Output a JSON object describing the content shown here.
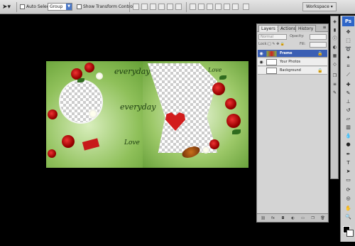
{
  "options_bar": {
    "auto_select_label": "Auto Select:",
    "auto_select_value": "Group",
    "transform_controls_label": "Show Transform Controls",
    "workspace_label": "Workspace"
  },
  "canvas_text": {
    "script1": "everyday",
    "script2": "everyday",
    "script3": "Love",
    "script4": "Love"
  },
  "layers_panel": {
    "tabs": [
      "Layers",
      "Actions",
      "History"
    ],
    "tab_close": "×",
    "blend_mode": "Normal",
    "opacity_label": "Opacity:",
    "lock_label": "Lock:",
    "fill_label": "Fill:",
    "layers": [
      {
        "name": "Frame",
        "selected": true,
        "visible": true,
        "locked": true
      },
      {
        "name": "Your Photos",
        "selected": false,
        "visible": true,
        "locked": false
      },
      {
        "name": "Background",
        "selected": false,
        "visible": false,
        "locked": true
      }
    ],
    "footer_icons": [
      "link-icon",
      "fx-icon",
      "mask-icon",
      "adjustment-icon",
      "folder-icon",
      "new-layer-icon",
      "trash-icon"
    ]
  },
  "toolbox": {
    "logo": "Ps"
  },
  "colors": {
    "selection": "#3b5fb4",
    "ps_brand": "#2f66c8"
  }
}
